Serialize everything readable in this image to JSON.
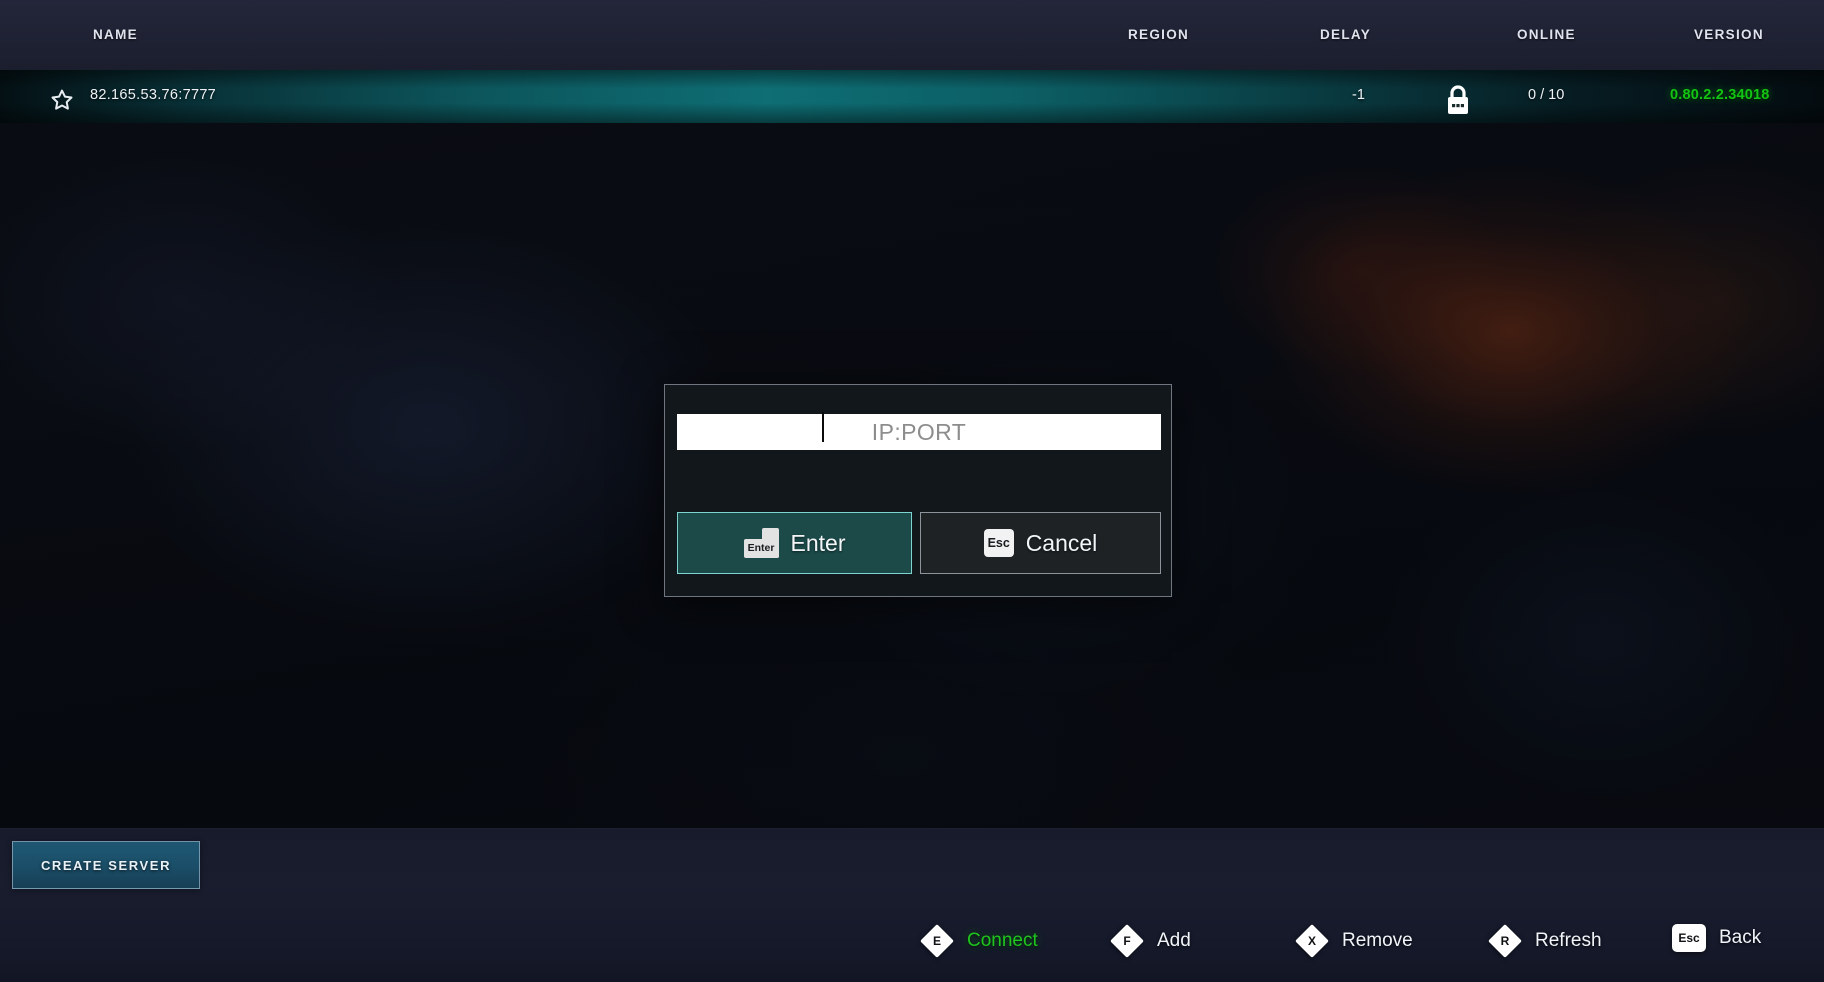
{
  "header": {
    "columns": [
      {
        "key": "name",
        "label": "NAME"
      },
      {
        "key": "region",
        "label": "REGION"
      },
      {
        "key": "delay",
        "label": "DELAY"
      },
      {
        "key": "online",
        "label": "ONLINE"
      },
      {
        "key": "version",
        "label": "VERSION"
      }
    ]
  },
  "server_row": {
    "favorite_icon": "star-icon",
    "name": "82.165.53.76:7777",
    "region": "",
    "delay": "-1",
    "locked_icon": "lock-icon",
    "online": "0 / 10",
    "version": "0.80.2.2.34018",
    "selected": true,
    "version_color": "#13c413",
    "row_accent_color": "#0e767c"
  },
  "bottom": {
    "create_server_label": "CREATE SERVER",
    "create_server_color": "#1b4f69"
  },
  "hints": [
    {
      "key": "E",
      "key_style": "diamond",
      "label": "Connect",
      "color": "#1fc41f"
    },
    {
      "key": "F",
      "key_style": "diamond",
      "label": "Add",
      "color": "#f1f4f8"
    },
    {
      "key": "X",
      "key_style": "diamond",
      "label": "Remove",
      "color": "#f1f4f8"
    },
    {
      "key": "R",
      "key_style": "diamond",
      "label": "Refresh",
      "color": "#f1f4f8"
    },
    {
      "key": "Esc",
      "key_style": "cap",
      "label": "Back",
      "color": "#f1f4f8"
    }
  ],
  "dialog": {
    "input": {
      "value": "",
      "placeholder": "IP:PORT",
      "caret_visible": true
    },
    "enter_button": {
      "key": "Enter",
      "label": "Enter",
      "fill": "#1b4a49",
      "border": "#7fd3d0"
    },
    "cancel_button": {
      "key": "Esc",
      "label": "Cancel",
      "fill": "#1e2225",
      "border": "#8d939b"
    }
  }
}
